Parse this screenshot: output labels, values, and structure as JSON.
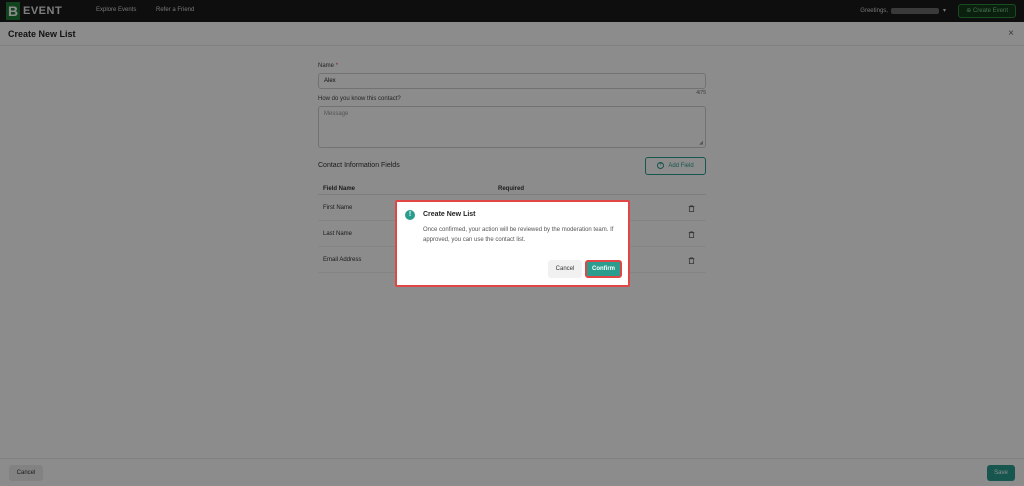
{
  "nav": {
    "logo_mark": "B",
    "logo_text": "EVENT",
    "links": [
      "Explore Events",
      "Refer a Friend"
    ],
    "greeting": "Greetings,",
    "create_event": "Create Event"
  },
  "page": {
    "title": "Create New List",
    "close": "×"
  },
  "form": {
    "name_label": "Name",
    "required_mark": "*",
    "name_value": "Alex",
    "name_counter": "4/75",
    "know_label": "How do you know this contact?",
    "message_placeholder": "Message",
    "section_title": "Contact Information Fields",
    "add_field": "Add Field"
  },
  "table": {
    "headers": [
      "Field Name",
      "Required"
    ],
    "rows": [
      {
        "name": "First Name"
      },
      {
        "name": "Last Name"
      },
      {
        "name": "Email Address"
      }
    ]
  },
  "footer": {
    "cancel": "Cancel",
    "save": "Save"
  },
  "dialog": {
    "icon": "!",
    "title": "Create New List",
    "message": "Once confirmed, your action will be reviewed by the moderation team. If approved, you can use the contact list.",
    "cancel": "Cancel",
    "confirm": "Confirm"
  },
  "colors": {
    "accent": "#2a9d8f",
    "highlight": "#e04646",
    "nav_bg": "#1a1a1a"
  }
}
